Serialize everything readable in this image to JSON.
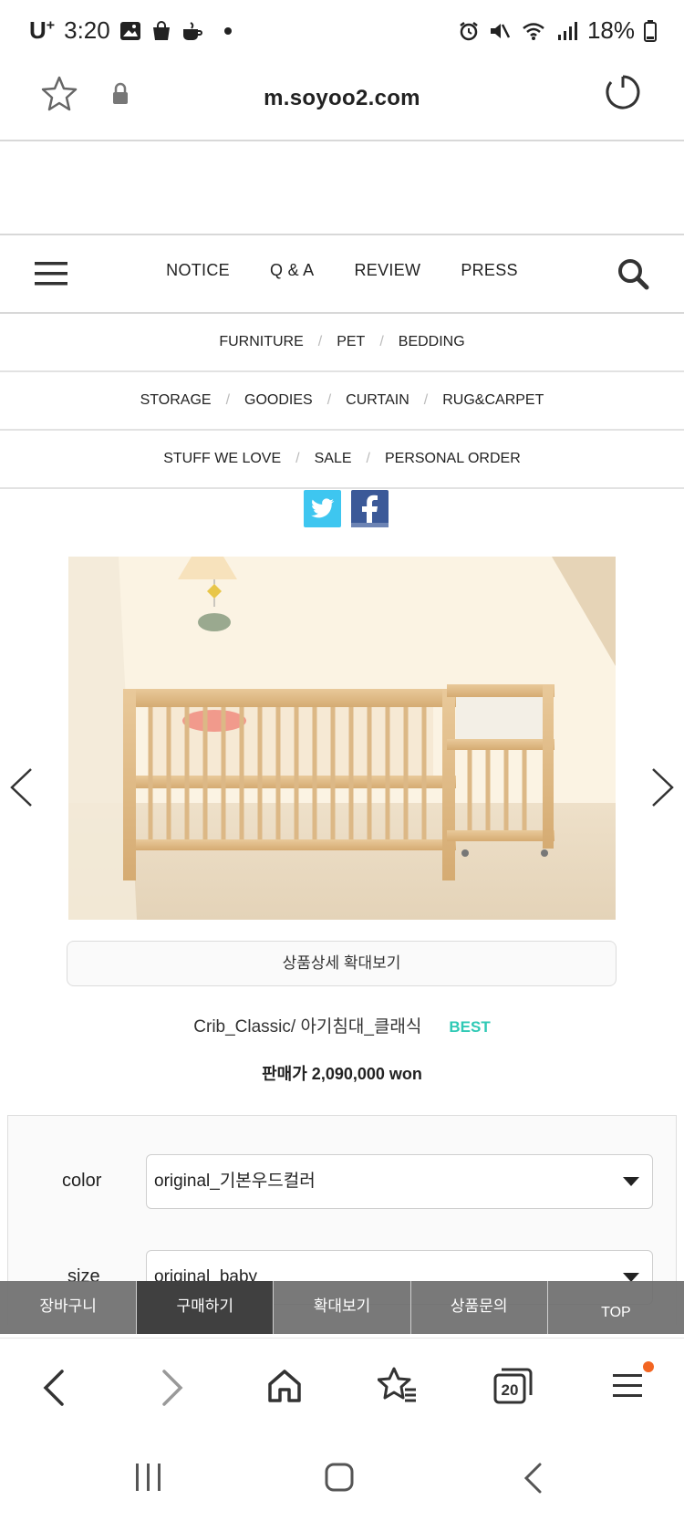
{
  "status_bar": {
    "carrier": "U",
    "carrier_sup": "+",
    "time": "3:20",
    "battery": "18%"
  },
  "browser": {
    "url": "m.soyoo2.com",
    "tab_count": "20"
  },
  "nav": {
    "links": [
      "NOTICE",
      "Q & A",
      "REVIEW",
      "PRESS"
    ]
  },
  "categories": {
    "row1": [
      "FURNITURE",
      "PET",
      "BEDDING"
    ],
    "row2": [
      "STORAGE",
      "GOODIES",
      "CURTAIN",
      "RUG&CARPET"
    ],
    "row3": [
      "STUFF WE LOVE",
      "SALE",
      "PERSONAL ORDER"
    ],
    "separator": "/"
  },
  "product": {
    "zoom_button": "상품상세 확대보기",
    "title": "Crib_Classic/ 아기침대_클래식",
    "badge": "BEST",
    "price": "판매가 2,090,000 won"
  },
  "options": {
    "color_label": "color",
    "color_value": "original_기본우드컬러",
    "size_label": "size",
    "size_value": "original_baby"
  },
  "action_bar": {
    "cart": "장바구니",
    "buy": "구매하기",
    "zoom": "확대보기",
    "inquiry": "상품문의",
    "top": "TOP"
  },
  "colors": {
    "badge": "#2fc9b5",
    "twitter": "#3ec6f0",
    "facebook": "#3b5998",
    "notification_dot": "#f26522"
  }
}
